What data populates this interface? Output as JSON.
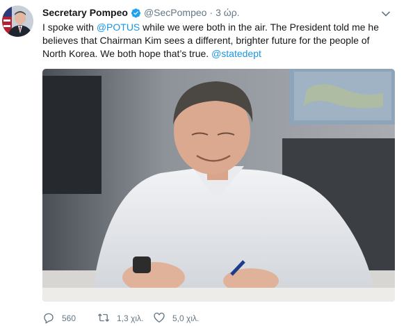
{
  "tweet": {
    "author_name": "Secretary Pompeo",
    "handle": "@SecPompeo",
    "separator": "·",
    "timestamp": "3 ώρ.",
    "text": {
      "line1_a": "I spoke with ",
      "mention_potus": "@POTUS",
      "line1_b": " while we were both in the air. The President told me he",
      "line2": "believes that Chairman Kim sees a different, brighter future for the people of",
      "line3": "North Korea. We both hope that’s true. ",
      "mention_statedept": "@statedept"
    }
  },
  "actions": {
    "reply_count": "560",
    "retweet_count": "1,3 χιλ.",
    "like_count": "5,0 χιλ."
  },
  "icons": {
    "verified": "verified-badge-icon",
    "menu": "chevron-down-icon",
    "reply": "reply-icon",
    "retweet": "retweet-icon",
    "like": "heart-icon"
  },
  "colors": {
    "link": "#1b95e0",
    "verified": "#1da1f2",
    "meta_text": "#657786",
    "icon": "#657786"
  }
}
